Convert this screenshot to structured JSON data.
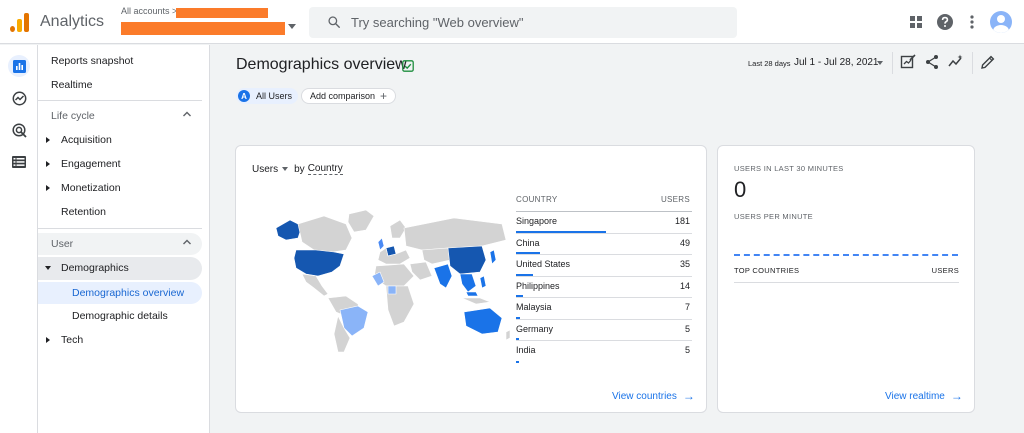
{
  "app": {
    "name": "Analytics"
  },
  "account": {
    "label": "All accounts",
    "chevron": ">"
  },
  "search": {
    "placeholder": "Try searching \"Web overview\""
  },
  "rail": {
    "icons": [
      "reports-icon",
      "explore-icon",
      "advertising-icon",
      "configure-icon"
    ]
  },
  "nav": {
    "reports_snapshot": "Reports snapshot",
    "realtime": "Realtime",
    "lifecycle": {
      "title": "Life cycle",
      "items": [
        "Acquisition",
        "Engagement",
        "Monetization",
        "Retention"
      ]
    },
    "user": {
      "title": "User",
      "demographics": "Demographics",
      "sub": [
        "Demographics overview",
        "Demographic details"
      ],
      "tech": "Tech"
    }
  },
  "page": {
    "title": "Demographics overview",
    "segment_badge": "A",
    "segment_label": "All Users",
    "add_comparison": "Add comparison",
    "date_label": "Last 28 days",
    "date_range": "Jul 1 - Jul 28, 2021"
  },
  "country_card": {
    "metric": "Users",
    "by": "by",
    "dimension": "Country",
    "col_country": "COUNTRY",
    "col_users": "USERS",
    "rows": [
      {
        "country": "Singapore",
        "users": "181",
        "share": 1.0
      },
      {
        "country": "China",
        "users": "49",
        "share": 0.27
      },
      {
        "country": "United States",
        "users": "35",
        "share": 0.19
      },
      {
        "country": "Philippines",
        "users": "14",
        "share": 0.08
      },
      {
        "country": "Malaysia",
        "users": "7",
        "share": 0.04
      },
      {
        "country": "Germany",
        "users": "5",
        "share": 0.03
      },
      {
        "country": "India",
        "users": "5",
        "share": 0.03
      }
    ],
    "link": "View countries"
  },
  "realtime_card": {
    "users_label": "USERS IN LAST 30 MINUTES",
    "users_value": "0",
    "per_minute_label": "USERS PER MINUTE",
    "col_countries": "TOP COUNTRIES",
    "col_users": "USERS",
    "link": "View realtime"
  },
  "colors": {
    "accent": "#1a73e8",
    "map_dark": "#1557b0",
    "map_mid": "#4a8af4",
    "map_light": "#8ab4f8",
    "map_none": "#d3d3d3",
    "redaction": "#fb7b2a"
  }
}
